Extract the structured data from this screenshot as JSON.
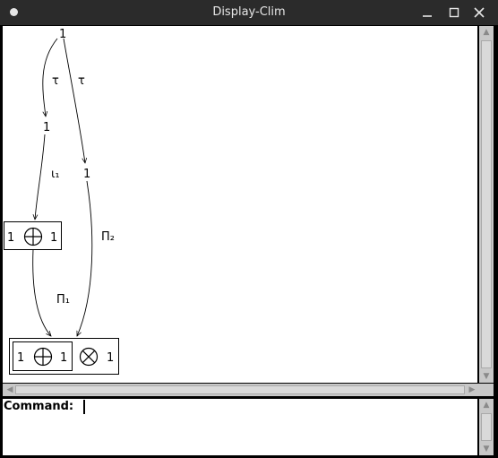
{
  "window": {
    "title": "Display-Clim"
  },
  "diagram": {
    "nodes": {
      "top": "1",
      "left": "1",
      "right": "1",
      "sum_left": "1",
      "sum_right": "1",
      "prod_sum_left": "1",
      "prod_sum_right": "1",
      "prod_right": "1"
    },
    "edges": {
      "tau_left": "τ",
      "tau_right": "τ",
      "iota1": "ι₁",
      "pi2": "Π₂",
      "pi1": "Π₁"
    }
  },
  "command": {
    "label": "Command:"
  }
}
